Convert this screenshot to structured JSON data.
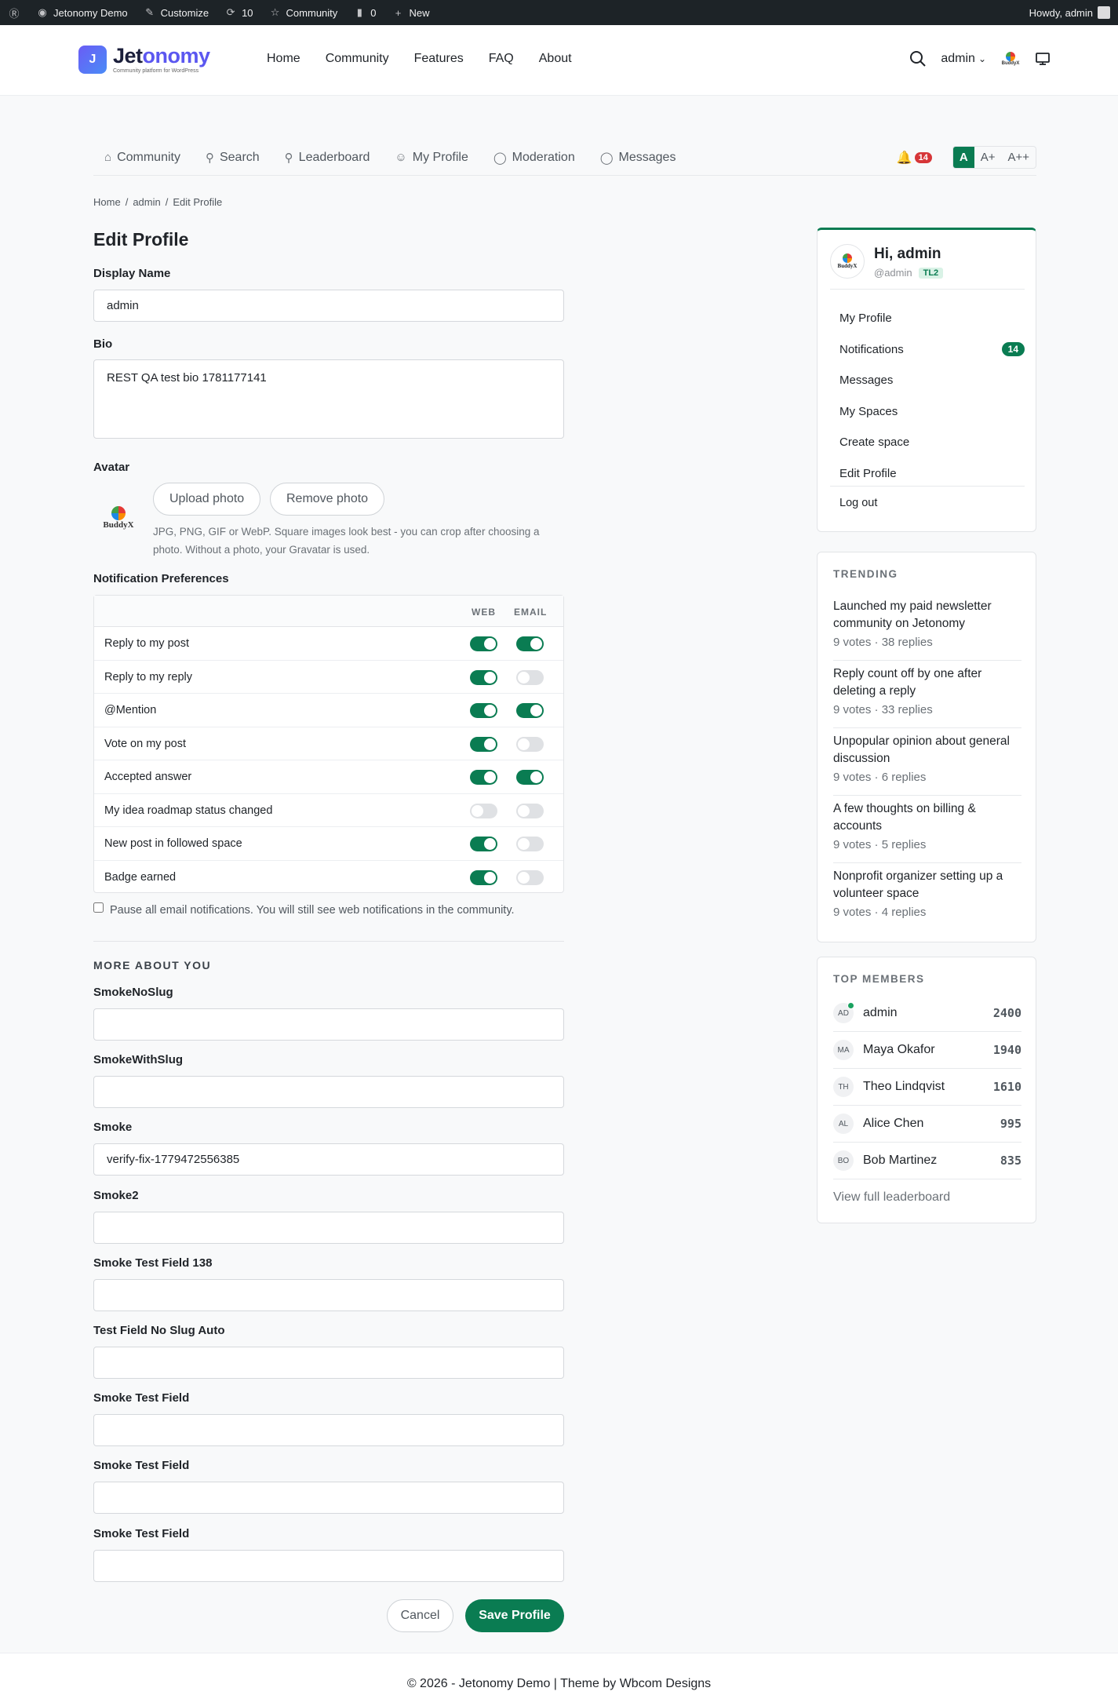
{
  "adminbar": {
    "site": "Jetonomy Demo",
    "customize": "Customize",
    "updates": "10",
    "community": "Community",
    "comments": "0",
    "new": "New",
    "howdy": "Howdy, admin"
  },
  "header": {
    "logo_a": "Jet",
    "logo_b": "onomy",
    "logo_mark": "J",
    "tagline": "Community platform for WordPress",
    "nav": [
      "Home",
      "Community",
      "Features",
      "FAQ",
      "About"
    ],
    "user": "admin",
    "buddyx": "BuddyX"
  },
  "commnav": {
    "items": [
      {
        "label": "Community",
        "icon": "home-icon"
      },
      {
        "label": "Search",
        "icon": "search-icon"
      },
      {
        "label": "Leaderboard",
        "icon": "trophy-icon"
      },
      {
        "label": "My Profile",
        "icon": "user-icon"
      },
      {
        "label": "Moderation",
        "icon": "shield-icon"
      },
      {
        "label": "Messages",
        "icon": "chat-icon"
      }
    ],
    "notif_count": "14",
    "font_sizes": [
      "A",
      "A+",
      "A++"
    ]
  },
  "breadcrumb": [
    "Home",
    "/",
    "admin",
    "/",
    "Edit Profile"
  ],
  "page_title": "Edit Profile",
  "form": {
    "display_name_label": "Display Name",
    "display_name_value": "admin",
    "bio_label": "Bio",
    "bio_value": "REST QA test bio 1781177141",
    "avatar_label": "Avatar",
    "upload_label": "Upload photo",
    "remove_label": "Remove photo",
    "avatar_hint": "JPG, PNG, GIF or WebP. Square images look best - you can crop after choosing a photo. Without a photo, your Gravatar is used.",
    "notif_label": "Notification Preferences",
    "web_header": "WEB",
    "email_header": "EMAIL",
    "notifications": [
      {
        "label": "Reply to my post",
        "web": true,
        "email": true
      },
      {
        "label": "Reply to my reply",
        "web": true,
        "email": false
      },
      {
        "label": "@Mention",
        "web": true,
        "email": true
      },
      {
        "label": "Vote on my post",
        "web": true,
        "email": false
      },
      {
        "label": "Accepted answer",
        "web": true,
        "email": true
      },
      {
        "label": "My idea roadmap status changed",
        "web": false,
        "email": false
      },
      {
        "label": "New post in followed space",
        "web": true,
        "email": false
      },
      {
        "label": "Badge earned",
        "web": true,
        "email": false
      }
    ],
    "pause_label": "Pause all email notifications. You will still see web notifications in the community.",
    "more_about": "MORE ABOUT YOU",
    "extra_fields": [
      {
        "label": "SmokeNoSlug",
        "value": ""
      },
      {
        "label": "SmokeWithSlug",
        "value": ""
      },
      {
        "label": "Smoke",
        "value": "verify-fix-1779472556385"
      },
      {
        "label": "Smoke2",
        "value": ""
      },
      {
        "label": "Smoke Test Field 138",
        "value": ""
      },
      {
        "label": "Test Field No Slug Auto",
        "value": ""
      },
      {
        "label": "Smoke Test Field",
        "value": ""
      },
      {
        "label": "Smoke Test Field",
        "value": ""
      },
      {
        "label": "Smoke Test Field",
        "value": ""
      }
    ],
    "cancel_label": "Cancel",
    "save_label": "Save Profile"
  },
  "usercard": {
    "greeting": "Hi, admin",
    "handle": "@admin",
    "trust_level": "TL2",
    "menu": [
      "My Profile",
      "Notifications",
      "Messages",
      "My Spaces",
      "Create space",
      "Edit Profile"
    ],
    "notif_badge": "14",
    "logout": "Log out"
  },
  "trending": {
    "heading": "TRENDING",
    "items": [
      {
        "title": "Launched my paid newsletter community on Jetonomy",
        "meta": "9 votes · 38 replies"
      },
      {
        "title": "Reply count off by one after deleting a reply",
        "meta": "9 votes · 33 replies"
      },
      {
        "title": "Unpopular opinion about general discussion",
        "meta": "9 votes · 6 replies"
      },
      {
        "title": "A few thoughts on billing & accounts",
        "meta": "9 votes · 5 replies"
      },
      {
        "title": "Nonprofit organizer setting up a volunteer space",
        "meta": "9 votes · 4 replies"
      }
    ]
  },
  "top_members": {
    "heading": "TOP MEMBERS",
    "members": [
      {
        "initials": "AD",
        "name": "admin",
        "score": "2400",
        "online": true
      },
      {
        "initials": "MA",
        "name": "Maya Okafor",
        "score": "1940",
        "online": false
      },
      {
        "initials": "TH",
        "name": "Theo Lindqvist",
        "score": "1610",
        "online": false
      },
      {
        "initials": "AL",
        "name": "Alice Chen",
        "score": "995",
        "online": false
      },
      {
        "initials": "BO",
        "name": "Bob Martinez",
        "score": "835",
        "online": false
      }
    ],
    "link": "View full leaderboard"
  },
  "footer": "© 2026 - Jetonomy Demo | Theme by Wbcom Designs",
  "colors": {
    "accent": "#0a7c52",
    "badge_red": "#d63638",
    "brand": "#5b57f0"
  }
}
